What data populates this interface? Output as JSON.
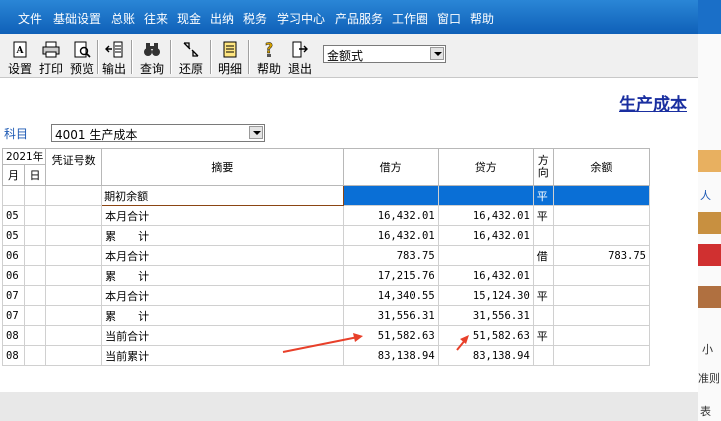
{
  "menu": [
    "文件",
    "基础设置",
    "总账",
    "往来",
    "现金",
    "出纳",
    "税务",
    "学习中心",
    "产品服务",
    "工作圈",
    "窗口",
    "帮助"
  ],
  "toolbar": {
    "buttons": [
      {
        "label": "设置",
        "icon": "settings-icon"
      },
      {
        "label": "打印",
        "icon": "printer-icon"
      },
      {
        "label": "预览",
        "icon": "preview-icon"
      },
      {
        "label": "输出",
        "icon": "export-icon"
      },
      {
        "label": "查询",
        "icon": "binoculars-icon"
      },
      {
        "label": "还原",
        "icon": "restore-icon"
      },
      {
        "label": "明细",
        "icon": "detail-list-icon"
      },
      {
        "label": "帮助",
        "icon": "help-icon"
      },
      {
        "label": "退出",
        "icon": "exit-icon"
      }
    ],
    "format_select": "金额式"
  },
  "report": {
    "title": "生产成本",
    "subject_label": "科目",
    "subject_value": "4001 生产成本"
  },
  "table": {
    "year_header": "2021年",
    "month_header": "月",
    "day_header": "日",
    "voucher_header": "凭证号数",
    "summary_header": "摘要",
    "debit_header": "借方",
    "credit_header": "贷方",
    "direction_header": "方向",
    "balance_header": "余额",
    "rows": [
      {
        "month": "",
        "day": "",
        "voucher": "",
        "summary": "期初余额",
        "debit": "",
        "credit": "",
        "direction": "平",
        "balance": ""
      },
      {
        "month": "05",
        "day": "",
        "voucher": "",
        "summary": "本月合计",
        "debit": "16,432.01",
        "credit": "16,432.01",
        "direction": "平",
        "balance": ""
      },
      {
        "month": "05",
        "day": "",
        "voucher": "",
        "summary": "累　　计",
        "debit": "16,432.01",
        "credit": "16,432.01",
        "direction": "",
        "balance": ""
      },
      {
        "month": "06",
        "day": "",
        "voucher": "",
        "summary": "本月合计",
        "debit": "783.75",
        "credit": "",
        "direction": "借",
        "balance": "783.75"
      },
      {
        "month": "06",
        "day": "",
        "voucher": "",
        "summary": "累　　计",
        "debit": "17,215.76",
        "credit": "16,432.01",
        "direction": "",
        "balance": ""
      },
      {
        "month": "07",
        "day": "",
        "voucher": "",
        "summary": "本月合计",
        "debit": "14,340.55",
        "credit": "15,124.30",
        "direction": "平",
        "balance": ""
      },
      {
        "month": "07",
        "day": "",
        "voucher": "",
        "summary": "累　　计",
        "debit": "31,556.31",
        "credit": "31,556.31",
        "direction": "",
        "balance": ""
      },
      {
        "month": "08",
        "day": "",
        "voucher": "",
        "summary": "当前合计",
        "debit": "51,582.63",
        "credit": "51,582.63",
        "direction": "平",
        "balance": ""
      },
      {
        "month": "08",
        "day": "",
        "voucher": "",
        "summary": "当前累计",
        "debit": "83,138.94",
        "credit": "83,138.94",
        "direction": "",
        "balance": ""
      }
    ]
  },
  "right_edge": {
    "texts": [
      "人",
      "小",
      "准则",
      "表"
    ]
  },
  "colors": {
    "menu_bar": "#1a6fc8",
    "selection": "#0a6fd6",
    "title": "#1a2fa0",
    "annotation_arrow": "#e8402a"
  }
}
